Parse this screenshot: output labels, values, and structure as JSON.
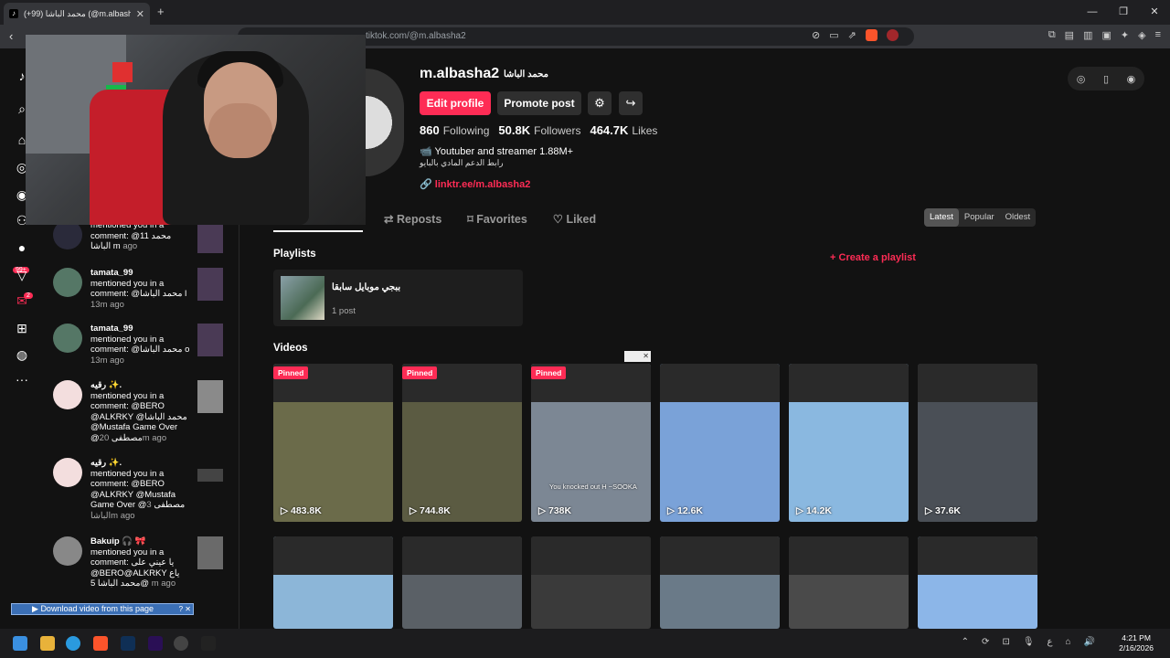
{
  "browser": {
    "tab_title": "(+99) محمد الباشا (@m.albasha2)",
    "address": "tiktok.com/@m.albasha2"
  },
  "rail": {
    "badges": {
      "inbox": "99+",
      "messages": "2"
    }
  },
  "notifications": [
    {
      "user": "",
      "text": "mentioned you in a comment: @11 محمد الباشا m",
      "ago": "ago"
    },
    {
      "user": "tamata_99",
      "text": "mentioned you in a comment: @محمد الباشا l",
      "ago": "13m ago"
    },
    {
      "user": "tamata_99",
      "text": "mentioned you in a comment: @محمد الباشا o",
      "ago": "13m ago"
    },
    {
      "user": "رقيه ✨.",
      "text": "mentioned you in a comment: @BERO @ALKRKY @محمد الباشا @Mustafa Game Over @مصطفى",
      "ago": "20m ago"
    },
    {
      "user": "رقيه ✨.",
      "text": "mentioned you in a comment: @BERO @ALKRKY @Mustafa Game Over @مصطفى",
      "ago": "3 الباشاm ago"
    },
    {
      "user": "Bakuip 🎧 🎀",
      "text": "mentioned you in a comment: يا عيني على @BERO@ALKRKY ياع @محمد الباشا 5",
      "ago": "m ago"
    }
  ],
  "profile": {
    "username": "m.albasha2",
    "nickname": "محمد الباشا",
    "edit_label": "Edit profile",
    "promote_label": "Promote post",
    "following_count": "860",
    "following_label": "Following",
    "followers_count": "50.8K",
    "followers_label": "Followers",
    "likes_count": "464.7K",
    "likes_label": "Likes",
    "bio_line1": "📹 Youtuber and streamer 1.88M+",
    "bio_line2": "رابط الدعم المادي بالبايو",
    "link": "linktr.ee/m.albasha2"
  },
  "tabs": {
    "reposts": "Reposts",
    "favorites": "Favorites",
    "liked": "Liked"
  },
  "sort": {
    "latest": "Latest",
    "popular": "Popular",
    "oldest": "Oldest"
  },
  "playlists": {
    "heading": "Playlists",
    "create": "Create a playlist",
    "item_name": "ببجي موبايل سابقا",
    "item_count": "1 post"
  },
  "videos": {
    "heading": "Videos",
    "pinned_label": "Pinned",
    "row1": [
      {
        "views": "483.8K",
        "pinned": true,
        "color": "#6b6b4a"
      },
      {
        "views": "744.8K",
        "pinned": true,
        "color": "#5b5b42"
      },
      {
        "views": "738K",
        "pinned": true,
        "color": "#7c8794",
        "caption": "You knocked out H ~SOOKA"
      },
      {
        "views": "12.6K",
        "pinned": false,
        "color": "#7aa2d8"
      },
      {
        "views": "14.2K",
        "pinned": false,
        "color": "#8ab8e0"
      },
      {
        "views": "37.6K",
        "pinned": false,
        "color": "#4a4f56"
      }
    ],
    "row2": [
      {
        "color": "#8cb6d8"
      },
      {
        "color": "#5a6066"
      },
      {
        "color": "#3a3a3a"
      },
      {
        "color": "#6a7a88"
      },
      {
        "color": "#4a4a4a"
      },
      {
        "color": "#8cb6e8"
      }
    ]
  },
  "download_bar": "Download video from this page",
  "clock": {
    "time": "4:21 PM",
    "date": "2/16/2026"
  },
  "colors": {
    "accent": "#fe2c55",
    "background": "#121212"
  }
}
